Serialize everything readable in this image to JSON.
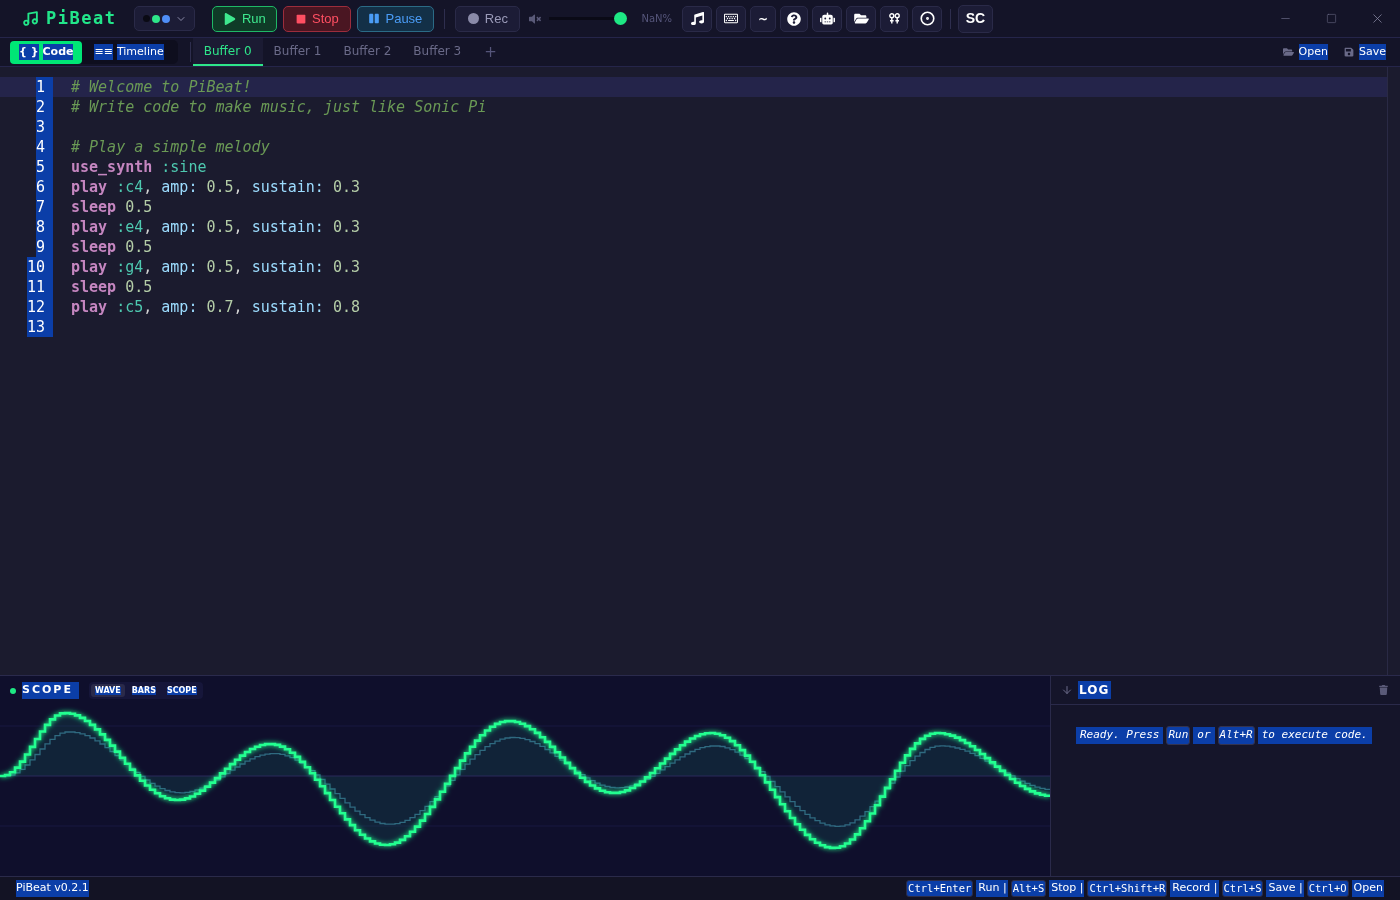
{
  "title_bar": {
    "app_name": "PiBeat",
    "theme_dots": [
      {
        "color": "#0a0a14"
      },
      {
        "color": "#2ee68a"
      },
      {
        "color": "#4f8ef7"
      }
    ]
  },
  "transport": [
    {
      "kind": "run",
      "label": "Run"
    },
    {
      "kind": "stop",
      "label": "Stop"
    },
    {
      "kind": "pause",
      "label": "Pause"
    },
    {
      "kind": "record",
      "label": "Rec"
    }
  ],
  "volume": {
    "muted": true,
    "level": 1,
    "reading": "NaN%"
  },
  "tools": {
    "wave_label": "~",
    "sc_label": "SC"
  },
  "text_selection": true,
  "view_toggle": [
    {
      "glyph": "{ }",
      "label": "Code",
      "selected": true
    },
    {
      "glyph": "≡≡",
      "label": "Timeline",
      "selected": false
    }
  ],
  "buffer_tabs": [
    {
      "label": "Buffer 0",
      "selected": true
    },
    {
      "label": "Buffer 1",
      "selected": false
    },
    {
      "label": "Buffer 2",
      "selected": false
    },
    {
      "label": "Buffer 3",
      "selected": false
    }
  ],
  "add_tab": {
    "label": "+"
  },
  "file_actions": [
    {
      "kind": "open",
      "label": "Open"
    },
    {
      "kind": "save",
      "label": "Save"
    }
  ],
  "editor": {
    "lines": [
      {
        "number": "1",
        "current": true,
        "tokens": [
          {
            "kind": "comment",
            "text": "# Welcome to PiBeat!"
          }
        ]
      },
      {
        "number": "2",
        "current": false,
        "tokens": [
          {
            "kind": "comment",
            "text": "# Write code to make music, just like Sonic Pi"
          }
        ]
      },
      {
        "number": "3",
        "current": false
      },
      {
        "number": "4",
        "current": false,
        "tokens": [
          {
            "kind": "comment",
            "text": "# Play a simple melody"
          }
        ]
      },
      {
        "number": "5",
        "current": false,
        "tokens": [
          {
            "kind": "keyword",
            "text": "use_synth"
          },
          {
            "kind": "symbol",
            "text": " :sine"
          }
        ]
      },
      {
        "number": "6",
        "current": false,
        "tokens": [
          {
            "kind": "keyword",
            "text": "play"
          },
          {
            "kind": "symbol",
            "text": " :c4"
          },
          {
            "kind": "punct",
            "text": ", "
          },
          {
            "kind": "key",
            "text": "amp:"
          },
          {
            "kind": "number",
            "text": " 0.5"
          },
          {
            "kind": "punct",
            "text": ", "
          },
          {
            "kind": "key",
            "text": "sustain:"
          },
          {
            "kind": "number",
            "text": " 0.3"
          }
        ]
      },
      {
        "number": "7",
        "current": false,
        "tokens": [
          {
            "kind": "keyword",
            "text": "sleep"
          },
          {
            "kind": "number",
            "text": " 0.5"
          }
        ]
      },
      {
        "number": "8",
        "current": false,
        "tokens": [
          {
            "kind": "keyword",
            "text": "play"
          },
          {
            "kind": "symbol",
            "text": " :e4"
          },
          {
            "kind": "punct",
            "text": ", "
          },
          {
            "kind": "key",
            "text": "amp:"
          },
          {
            "kind": "number",
            "text": " 0.5"
          },
          {
            "kind": "punct",
            "text": ", "
          },
          {
            "kind": "key",
            "text": "sustain:"
          },
          {
            "kind": "number",
            "text": " 0.3"
          }
        ]
      },
      {
        "number": "9",
        "current": false,
        "tokens": [
          {
            "kind": "keyword",
            "text": "sleep"
          },
          {
            "kind": "number",
            "text": " 0.5"
          }
        ]
      },
      {
        "number": "10",
        "current": false,
        "tokens": [
          {
            "kind": "keyword",
            "text": "play"
          },
          {
            "kind": "symbol",
            "text": " :g4"
          },
          {
            "kind": "punct",
            "text": ", "
          },
          {
            "kind": "key",
            "text": "amp:"
          },
          {
            "kind": "number",
            "text": " 0.5"
          },
          {
            "kind": "punct",
            "text": ", "
          },
          {
            "kind": "key",
            "text": "sustain:"
          },
          {
            "kind": "number",
            "text": " 0.3"
          }
        ]
      },
      {
        "number": "11",
        "current": false,
        "tokens": [
          {
            "kind": "keyword",
            "text": "sleep"
          },
          {
            "kind": "number",
            "text": " 0.5"
          }
        ]
      },
      {
        "number": "12",
        "current": false,
        "tokens": [
          {
            "kind": "keyword",
            "text": "play"
          },
          {
            "kind": "symbol",
            "text": " :c5"
          },
          {
            "kind": "punct",
            "text": ", "
          },
          {
            "kind": "key",
            "text": "amp:"
          },
          {
            "kind": "number",
            "text": " 0.7"
          },
          {
            "kind": "punct",
            "text": ", "
          },
          {
            "kind": "key",
            "text": "sustain:"
          },
          {
            "kind": "number",
            "text": " 0.8"
          }
        ]
      },
      {
        "number": "13",
        "current": false
      }
    ]
  },
  "scope": {
    "title": "SCOPE",
    "modes": [
      {
        "label": "WAVE",
        "selected": true
      },
      {
        "label": "BARS",
        "selected": false
      },
      {
        "label": "SCOPE",
        "selected": false
      }
    ]
  },
  "log": {
    "title": "LOG",
    "message": [
      {
        "kind": "text",
        "text": "Ready. Press"
      },
      {
        "kind": "key",
        "text": "Run"
      },
      {
        "kind": "text",
        "text": "or"
      },
      {
        "kind": "key",
        "text": "Alt+R"
      },
      {
        "kind": "text",
        "text": "to execute code."
      }
    ]
  },
  "status_bar": {
    "version": "PiBeat v0.2.1",
    "shortcuts": [
      {
        "key": "Ctrl+Enter",
        "action": "Run |"
      },
      {
        "key": "Alt+S",
        "action": "Stop |"
      },
      {
        "key": "Ctrl+Shift+R",
        "action": "Record |"
      },
      {
        "key": "Ctrl+S",
        "action": "Save |"
      },
      {
        "key": "Ctrl+O",
        "action": "Open"
      }
    ]
  }
}
